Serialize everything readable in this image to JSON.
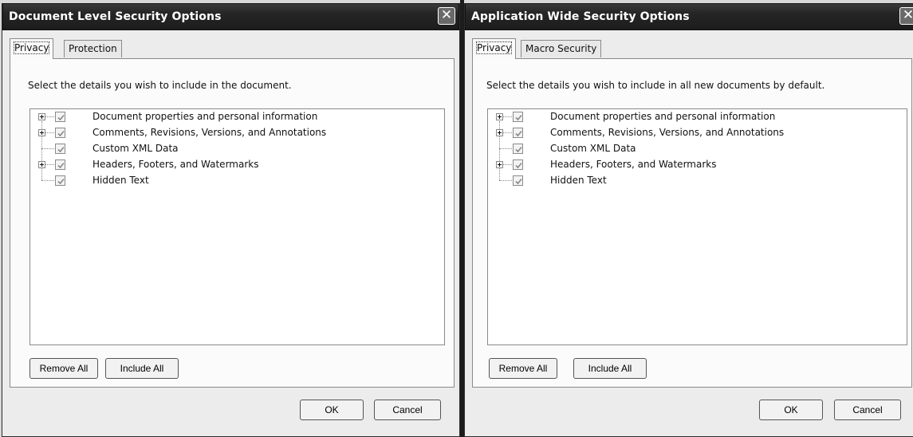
{
  "left_dialog": {
    "title": "Document Level Security Options",
    "close_glyph": "✕",
    "tabs": [
      {
        "label": "Privacy",
        "active": true
      },
      {
        "label": "Protection",
        "active": false
      }
    ],
    "instruction": "Select the details you wish to include in the document.",
    "tree_items": [
      {
        "label": "Document properties and personal information",
        "expandable": true,
        "checked": true
      },
      {
        "label": "Comments, Revisions, Versions, and Annotations",
        "expandable": true,
        "checked": true
      },
      {
        "label": "Custom XML Data",
        "expandable": false,
        "checked": true
      },
      {
        "label": "Headers, Footers, and Watermarks",
        "expandable": true,
        "checked": true
      },
      {
        "label": "Hidden Text",
        "expandable": false,
        "checked": true
      }
    ],
    "remove_all_label": "Remove All",
    "include_all_label": "Include All",
    "ok_label": "OK",
    "cancel_label": "Cancel"
  },
  "right_dialog": {
    "title": "Application Wide Security Options",
    "close_glyph": "✕",
    "tabs": [
      {
        "label": "Privacy",
        "active": true
      },
      {
        "label": "Macro Security",
        "active": false
      }
    ],
    "instruction": "Select the details you wish to include in all new documents by default.",
    "tree_items": [
      {
        "label": "Document properties and personal information",
        "expandable": true,
        "checked": true
      },
      {
        "label": "Comments, Revisions, Versions, and Annotations",
        "expandable": true,
        "checked": true
      },
      {
        "label": "Custom XML Data",
        "expandable": false,
        "checked": true
      },
      {
        "label": "Headers, Footers, and Watermarks",
        "expandable": true,
        "checked": true
      },
      {
        "label": "Hidden Text",
        "expandable": false,
        "checked": true
      }
    ],
    "remove_all_label": "Remove All",
    "include_all_label": "Include All",
    "ok_label": "OK",
    "cancel_label": "Cancel"
  },
  "colors": {
    "titlebar": "#262626",
    "dialog_background": "#ececec",
    "check_mark": "#8a8a8a"
  }
}
